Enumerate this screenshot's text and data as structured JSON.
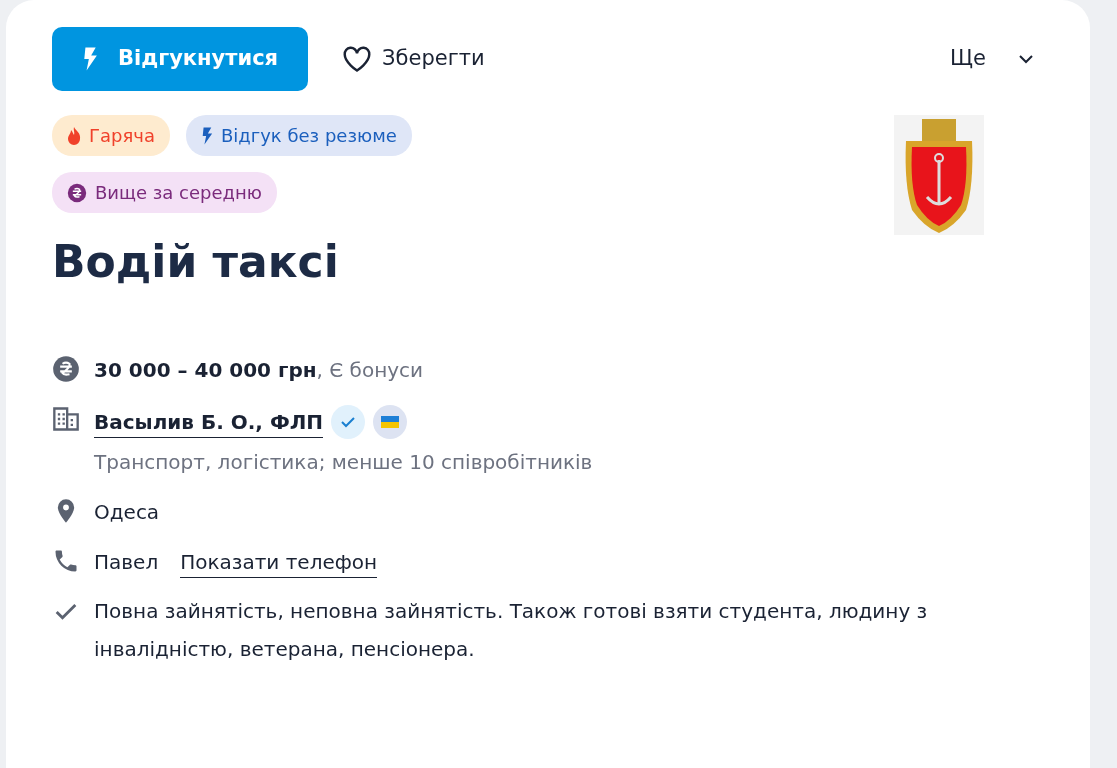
{
  "actions": {
    "apply": "Відгукнутися",
    "save": "Зберегти",
    "more": "Ще"
  },
  "tags": [
    {
      "kind": "hot",
      "label": "Гаряча"
    },
    {
      "kind": "quick",
      "label": "Відгук без резюме"
    },
    {
      "kind": "salary",
      "label": "Вище за середню"
    }
  ],
  "title": "Водій таксі",
  "salary": {
    "amount": "30 000 – 40 000 грн",
    "note": ", Є бонуси"
  },
  "company": {
    "name": "Васылив Б. О., ФЛП",
    "verified": true,
    "details": "Транспорт, логістика; менше 10 співробітників"
  },
  "location": "Одеса",
  "contact": {
    "name": "Павел",
    "phone_link": "Показати телефон"
  },
  "employment": "Повна зайнятість, неповна зайнятість. Також готові взяти студента, людину з інвалідністю, ветерана, пенсіонера."
}
